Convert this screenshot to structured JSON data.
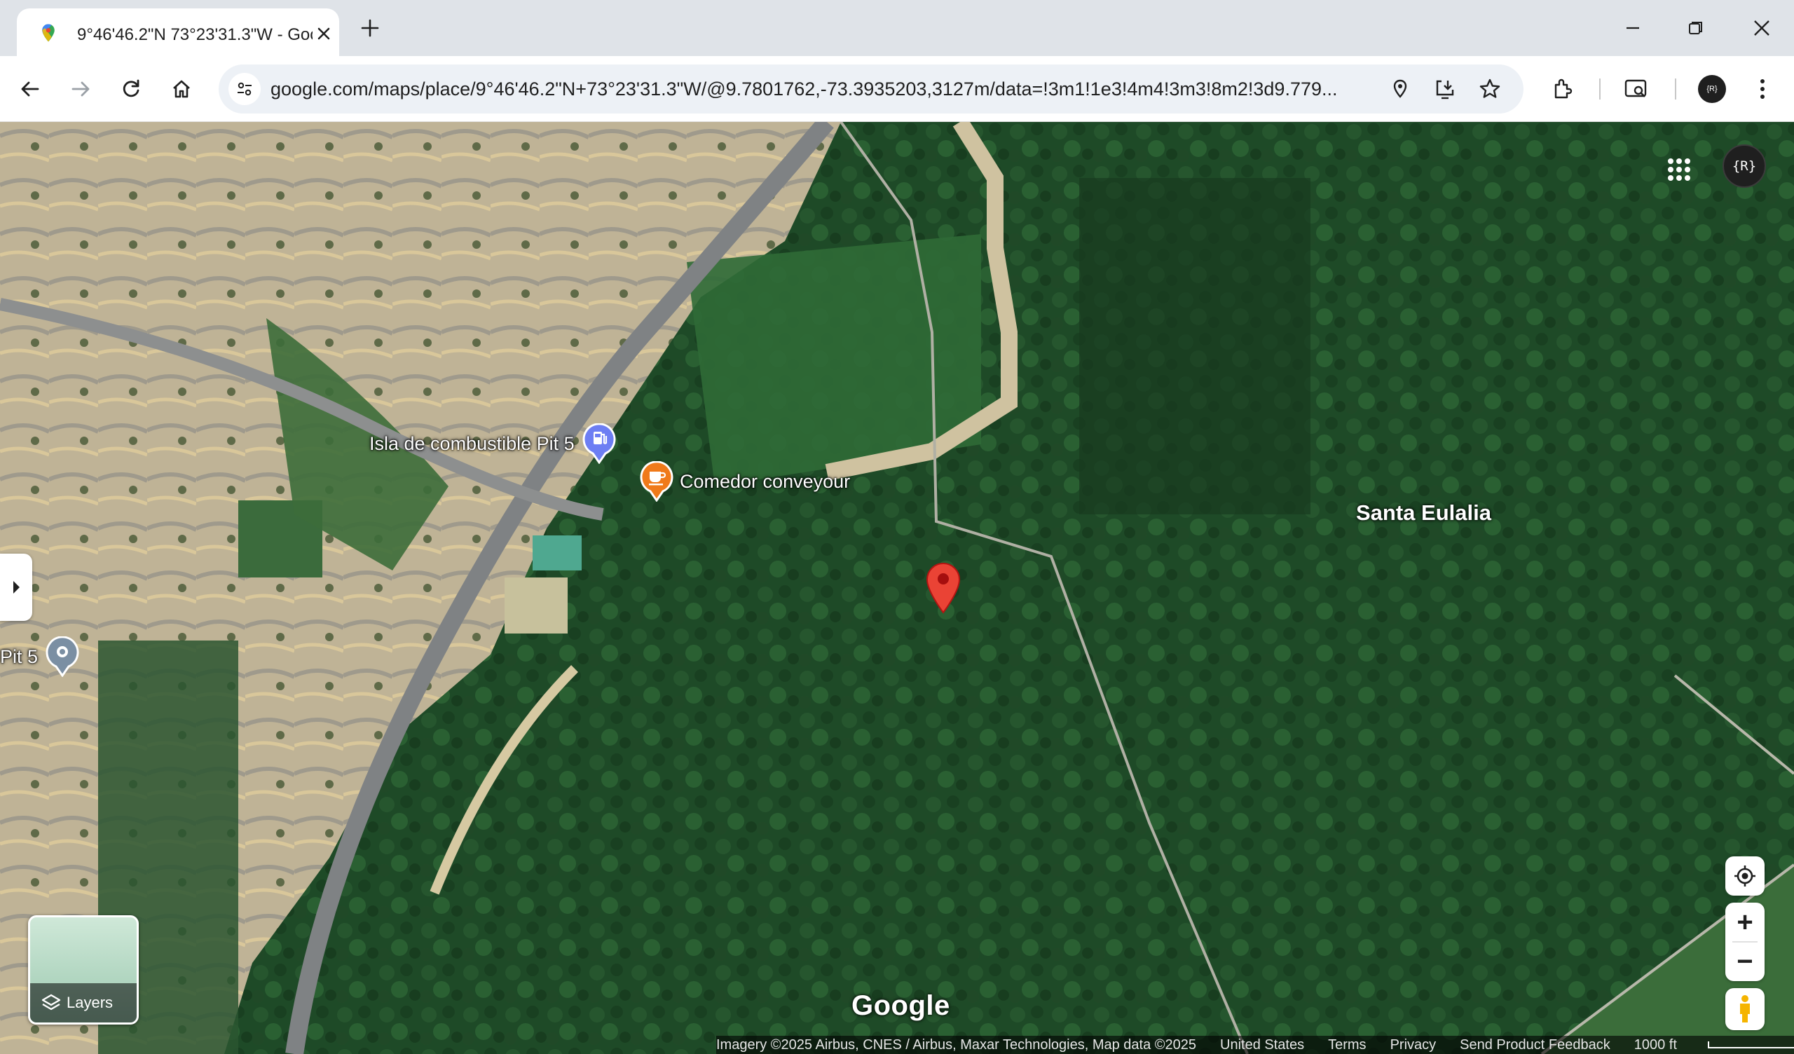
{
  "browser": {
    "tab": {
      "title": "9°46'46.2\"N 73°23'31.3\"W - Google Maps",
      "favicon": "google-maps-pin-icon"
    },
    "omnibox": {
      "url": "google.com/maps/place/9°46'46.2\"N+73°23'31.3\"W/@9.7801762,-73.3935203,3127m/data=!3m1!1e3!4m4!3m3!8m2!3d9.779..."
    },
    "icons": [
      "back-icon",
      "forward-icon",
      "reload-icon",
      "home-icon",
      "site-info-icon",
      "location-icon",
      "install-app-icon",
      "bookmark-star-icon",
      "extensions-icon",
      "lens-search-icon",
      "menu-dots-icon"
    ],
    "profile_badge": "{R}"
  },
  "map": {
    "mode": "satellite",
    "pois": [
      {
        "label": "Isla de combustible Pit 5",
        "icon": "gas-station-icon",
        "color": "#6d7ef3"
      },
      {
        "label": "Comedor conveyour",
        "icon": "cafe-icon",
        "color": "#f07a1a"
      },
      {
        "label": "Pit 5",
        "icon": "place-icon",
        "color": "#7b8fa3"
      }
    ],
    "place_label": "Santa Eulalia",
    "marker_color": "#ea4335",
    "account_badge": "{R}",
    "controls": {
      "layers_label": "Layers",
      "zoom_in": "+",
      "zoom_out": "−"
    },
    "logo": "Google",
    "footer": {
      "attribution": "Imagery ©2025 Airbus, CNES / Airbus, Maxar Technologies, Map data ©2025",
      "country": "United States",
      "terms": "Terms",
      "privacy": "Privacy",
      "feedback": "Send Product Feedback",
      "scale": "1000 ft"
    }
  }
}
